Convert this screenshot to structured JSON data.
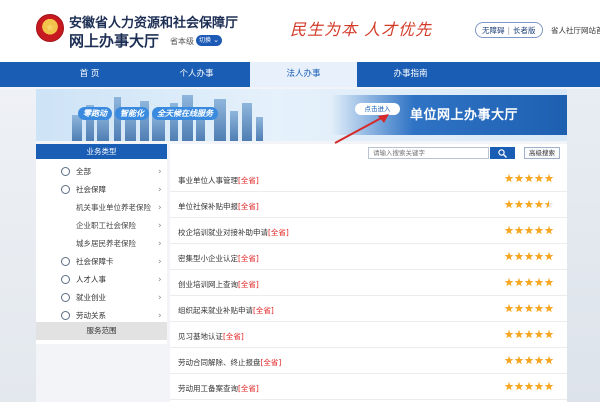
{
  "header": {
    "site_name": "安徽省人力资源和社会保障厅",
    "site_sub": "网上办事大厅",
    "emblem_glyph": "★",
    "level_label": "省本级",
    "switch_label": "切换",
    "slogan": "民生为本 人才优先",
    "access_barrier_free": "无障碍",
    "access_divider": "|",
    "access_elderly": "长者版",
    "province_link": "省人社厅网站首"
  },
  "nav": {
    "items": [
      {
        "label": "首 页"
      },
      {
        "label": "个人办事"
      },
      {
        "label": "法人办事"
      },
      {
        "label": "办事指南"
      }
    ],
    "active_index": 2
  },
  "banner": {
    "tags": [
      "零跑动",
      "智能化",
      "全天候在线服务"
    ],
    "enter_label": "点击进入",
    "hall_title": "单位网上办事大厅"
  },
  "sidebar": {
    "header": "业务类型",
    "items": [
      {
        "label": "全部",
        "icon": "grid-icon",
        "chevron": "›"
      },
      {
        "label": "社会保障",
        "icon": "shield-icon",
        "chevron": "›"
      },
      {
        "label": "机关事业单位养老保险",
        "icon": "",
        "chevron": "›"
      },
      {
        "label": "企业职工社会保险",
        "icon": "",
        "chevron": "›"
      },
      {
        "label": "城乡居民养老保险",
        "icon": "",
        "chevron": "›"
      },
      {
        "label": "社会保障卡",
        "icon": "card-icon",
        "chevron": "›"
      },
      {
        "label": "人才人事",
        "icon": "people-icon",
        "chevron": "›"
      },
      {
        "label": "就业创业",
        "icon": "briefcase-icon",
        "chevron": "›"
      },
      {
        "label": "劳动关系",
        "icon": "handshake-icon",
        "chevron": "›"
      }
    ],
    "footer": "服务范围"
  },
  "search": {
    "placeholder": "请输入搜索关键字",
    "advanced_label": "高级搜索"
  },
  "services": [
    {
      "name": "事业单位人事管理",
      "tag": "[全省]",
      "rating": 5
    },
    {
      "name": "单位社保补贴申报",
      "tag": "[全省]",
      "rating": 4.5
    },
    {
      "name": "校企培训就业对接补助申请",
      "tag": "[全省]",
      "rating": 5
    },
    {
      "name": "密集型小企业认定",
      "tag": "[全省]",
      "rating": 5
    },
    {
      "name": "创业培训网上查询",
      "tag": "[全省]",
      "rating": 5
    },
    {
      "name": "组织起来就业补贴申请",
      "tag": "[全省]",
      "rating": 5
    },
    {
      "name": "见习基地认证",
      "tag": "[全省]",
      "rating": 5
    },
    {
      "name": "劳动合同解除、终止报盘",
      "tag": "[全省]",
      "rating": 5
    },
    {
      "name": "劳动用工备案查询",
      "tag": "[全省]",
      "rating": 5
    }
  ],
  "colors": {
    "primary": "#1a5db4",
    "star": "#f5a623",
    "tag": "#e02020"
  }
}
